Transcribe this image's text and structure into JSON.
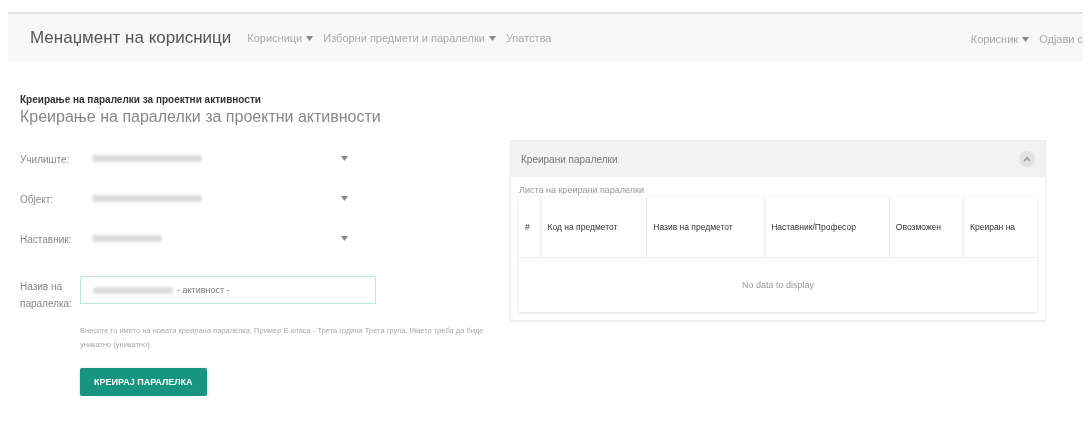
{
  "navbar": {
    "brand": "Менаџмент на корисници",
    "left_items": [
      {
        "label": "Корисници",
        "dropdown": true
      },
      {
        "label": "Изборни предмети и паралелки",
        "dropdown": true
      },
      {
        "label": "Упатства",
        "dropdown": false
      }
    ],
    "right_items": [
      {
        "label": "Корисник",
        "dropdown": true
      },
      {
        "label": "Одјави с",
        "dropdown": false
      }
    ]
  },
  "page": {
    "title": "Креирање на паралелки за проектни активности",
    "subtitle": "Креирање на паралелки за проектни активности"
  },
  "form": {
    "fields": [
      {
        "kind": "select",
        "label": "Училиште:"
      },
      {
        "kind": "select",
        "label": "Објект:"
      },
      {
        "kind": "select",
        "label": "Наставник:"
      },
      {
        "kind": "text",
        "label": "Назив на паралелка:",
        "value": "- активност -",
        "focused": true
      }
    ],
    "help": "Внесете го името на новата креирана паралелка. Пример Е-класа - Трета година Трета група. Името треба да биде уникатно (уникатно)",
    "submit": "КРЕИРАЈ ПАРАЛЕЛКА"
  },
  "panel": {
    "title": "Креирани паралелки",
    "expanded": true,
    "caption": "Листа на креирани паралелки",
    "table": {
      "columns": [
        "#",
        "Код на предметот",
        "Назив на предметот",
        "Наставник/Професор",
        "Овозможен",
        "Креиран на"
      ],
      "empty_text": "No data to display"
    }
  }
}
